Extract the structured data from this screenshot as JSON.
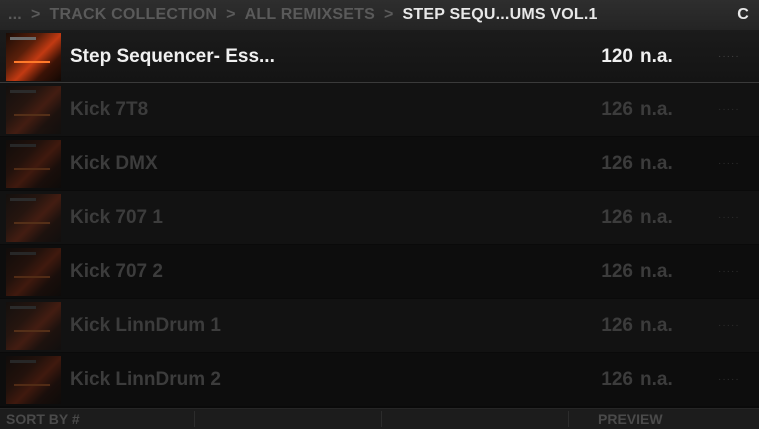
{
  "breadcrumb": {
    "ellipsis": "...",
    "separator": ">",
    "items": [
      "TRACK COLLECTION",
      "ALL REMIXSETS",
      "STEP SEQU...UMS VOL.1"
    ],
    "right_label": "C"
  },
  "tracks": [
    {
      "title": "Step Sequencer- Ess...",
      "bpm": "120",
      "key": "n.a.",
      "rating": "·····",
      "selected": true
    },
    {
      "title": "Kick 7T8",
      "bpm": "126",
      "key": "n.a.",
      "rating": "·····",
      "selected": false
    },
    {
      "title": "Kick DMX",
      "bpm": "126",
      "key": "n.a.",
      "rating": "·····",
      "selected": false
    },
    {
      "title": "Kick 707 1",
      "bpm": "126",
      "key": "n.a.",
      "rating": "·····",
      "selected": false
    },
    {
      "title": "Kick 707 2",
      "bpm": "126",
      "key": "n.a.",
      "rating": "·····",
      "selected": false
    },
    {
      "title": "Kick LinnDrum 1",
      "bpm": "126",
      "key": "n.a.",
      "rating": "·····",
      "selected": false
    },
    {
      "title": "Kick LinnDrum 2",
      "bpm": "126",
      "key": "n.a.",
      "rating": "·····",
      "selected": false
    }
  ],
  "footer": {
    "sort_label": "SORT BY #",
    "preview_label": "PREVIEW"
  }
}
